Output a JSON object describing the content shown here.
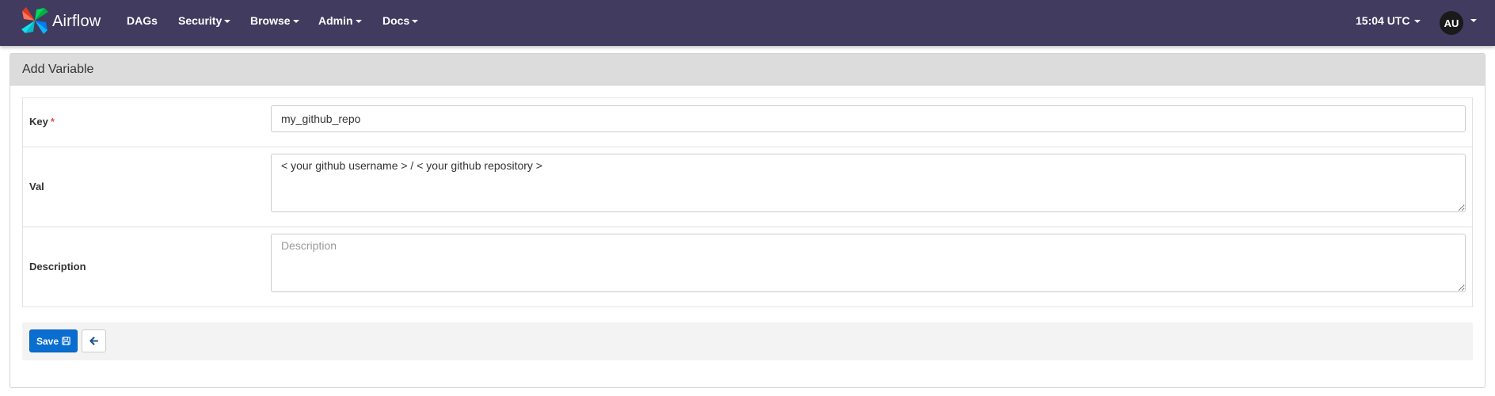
{
  "navbar": {
    "brand": "Airflow",
    "menu": [
      {
        "label": "DAGs"
      },
      {
        "label": "Security"
      },
      {
        "label": "Browse"
      },
      {
        "label": "Admin"
      },
      {
        "label": "Docs"
      }
    ],
    "time": "15:04 UTC",
    "avatar_initials": "AU",
    "background": "#403b5f"
  },
  "panel": {
    "title": "Add Variable"
  },
  "form": {
    "key": {
      "label": "Key",
      "required_mark": "*",
      "value": "my_github_repo"
    },
    "val": {
      "label": "Val",
      "value": "< your github username > / < your github repository >"
    },
    "description": {
      "label": "Description",
      "placeholder": "Description",
      "value": ""
    }
  },
  "actions": {
    "save_label": "Save",
    "save_icon": "floppy-disk-icon",
    "back_icon": "arrow-left-icon",
    "save_color": "#0a6ed0"
  }
}
